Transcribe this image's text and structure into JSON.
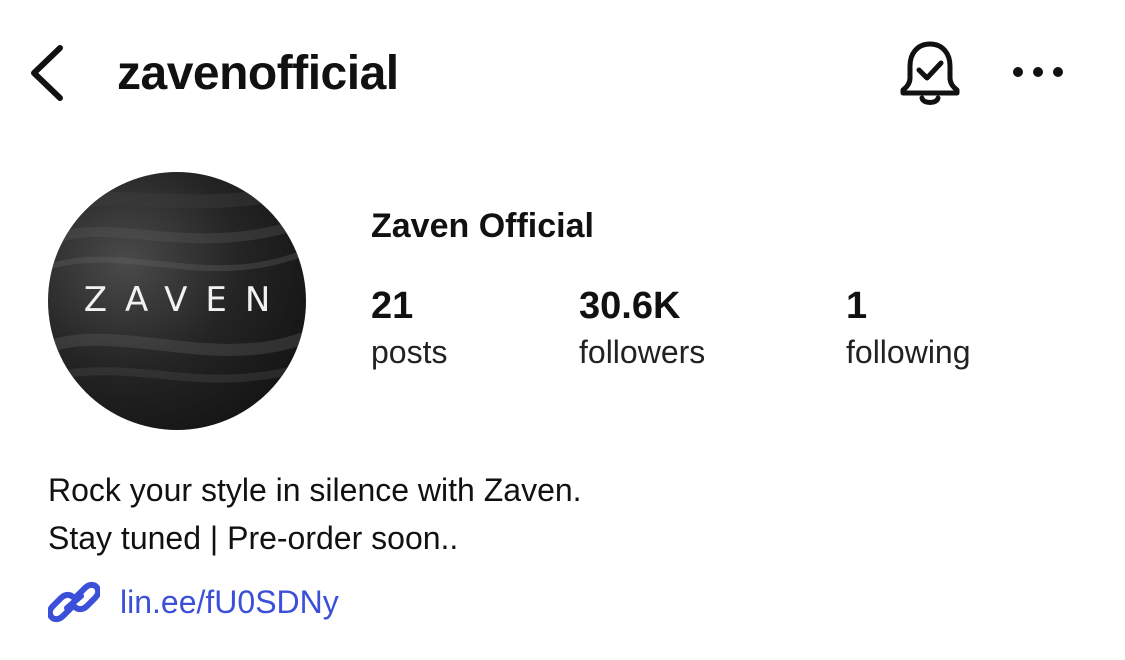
{
  "header": {
    "username": "zavenofficial",
    "back_icon": "chevron-left-icon",
    "notification_icon": "bell-check-icon",
    "more_icon": "more-horizontal-icon"
  },
  "profile": {
    "avatar_text": "ZAVEN",
    "display_name": "Zaven Official",
    "stats": {
      "posts": {
        "count": "21",
        "label": "posts"
      },
      "followers": {
        "count": "30.6K",
        "label": "followers"
      },
      "following": {
        "count": "1",
        "label": "following"
      }
    },
    "bio": {
      "line1": "Rock your style in silence with Zaven.",
      "line2": "Stay tuned | Pre-order soon.."
    },
    "link": {
      "text": "lin.ee/fU0SDNy",
      "icon": "link-icon",
      "color": "#3b4fd9"
    }
  }
}
